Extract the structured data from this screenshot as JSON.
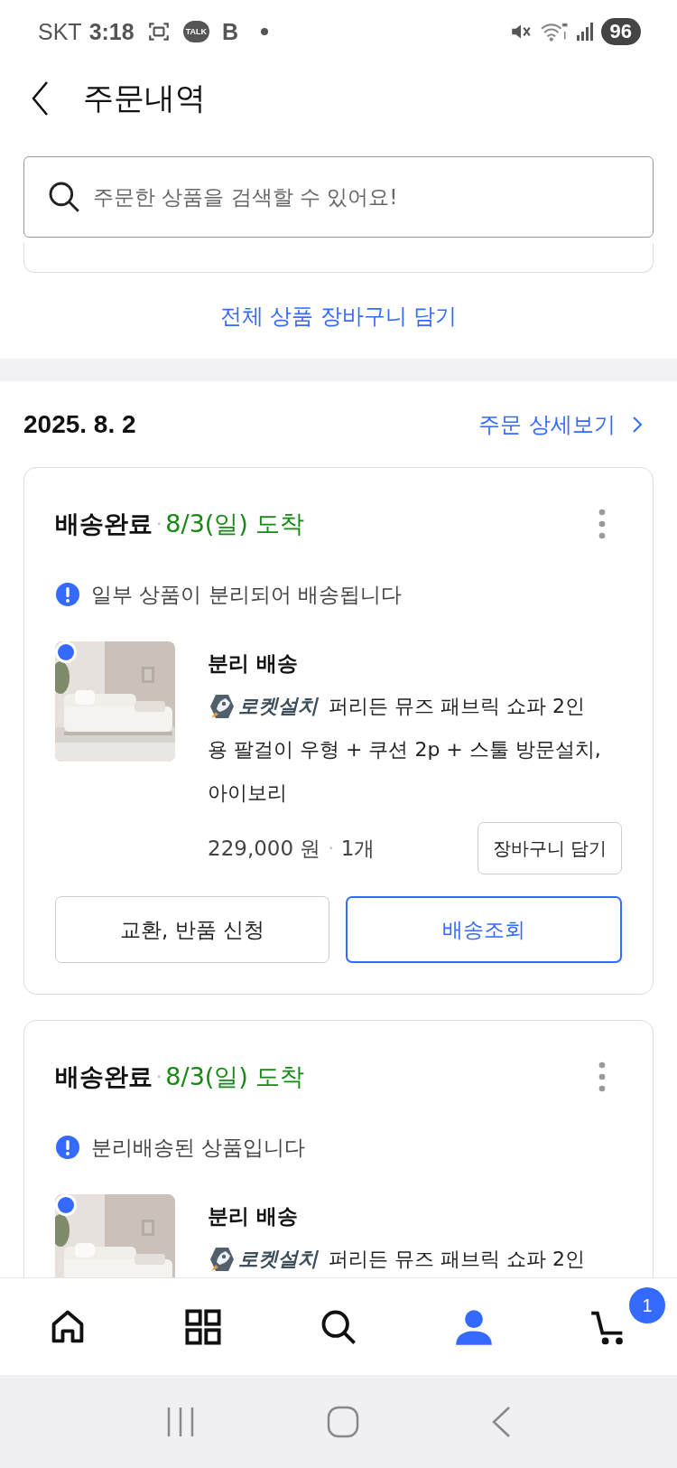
{
  "status_bar": {
    "carrier": "SKT",
    "time": "3:18",
    "talk": "TALK",
    "b": "B",
    "battery": "96"
  },
  "header": {
    "title": "주문내역"
  },
  "search": {
    "placeholder": "주문한 상품을 검색할 수 있어요!"
  },
  "add_all_link": "전체 상품 장바구니 담기",
  "order": {
    "date": "2025. 8. 2",
    "detail_link": "주문 상세보기",
    "cards": [
      {
        "status": "배송완료",
        "status_separator": "·",
        "arrival": "8/3(일) 도착",
        "notice": "일부 상품이 분리되어 배송됩니다",
        "group_title": "분리 배송",
        "badge": "로켓설치",
        "name": "퍼리든 뮤즈 패브릭 쇼파 2인",
        "name_continued": "용 팔걸이 우형 + 쿠션 2p + 스툴 방문설치, 아이보리",
        "price": "229,000 원",
        "price_separator": "·",
        "quantity": "1개",
        "cart_button": "장바구니 담기",
        "actions": [
          {
            "label": "교환, 반품 신청",
            "kind": "plain"
          },
          {
            "label": "배송조회",
            "kind": "primary"
          }
        ]
      },
      {
        "status": "배송완료",
        "status_separator": "·",
        "arrival": "8/3(일) 도착",
        "notice": "분리배송된 상품입니다",
        "group_title": "분리 배송",
        "badge": "로켓설치",
        "name": "퍼리든 뮤즈 패브릭 쇼파 2인"
      }
    ]
  },
  "bottom_nav": [
    {
      "kind": "home",
      "selected": false
    },
    {
      "kind": "categories",
      "selected": false
    },
    {
      "kind": "search",
      "selected": false
    },
    {
      "kind": "profile",
      "selected": true
    },
    {
      "kind": "cart",
      "selected": false,
      "badge": "1"
    }
  ]
}
